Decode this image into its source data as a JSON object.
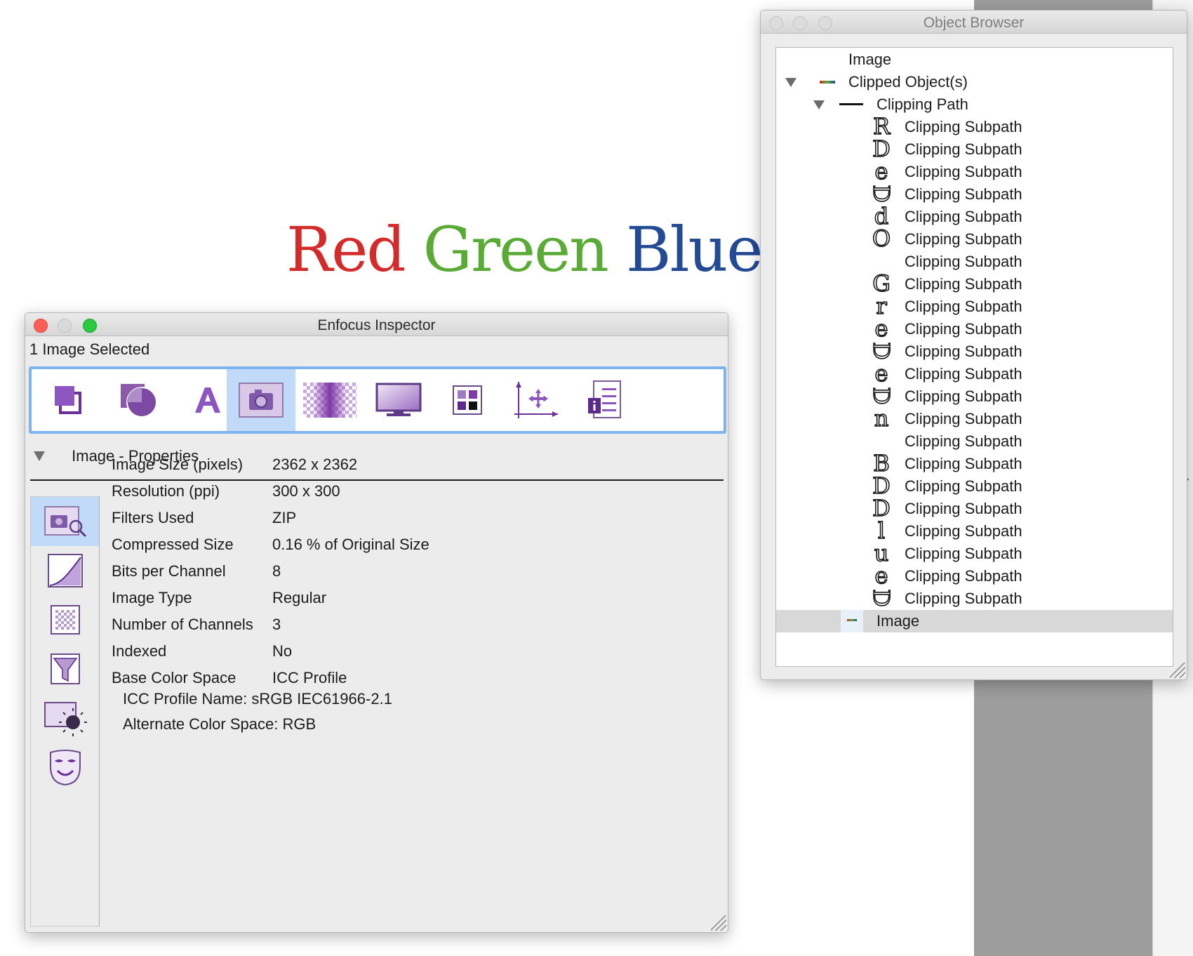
{
  "headline": {
    "red": "Red",
    "green": "Green",
    "blue": "Blue"
  },
  "colors": {
    "red": "#d42a2a",
    "green": "#5aab36",
    "blue": "#234a95",
    "accent": "#7fb3f0",
    "icon_purple": "#7b3fa6"
  },
  "inspector": {
    "title": "Enfocus Inspector",
    "selection": "1 Image Selected",
    "toolbar": [
      {
        "icon": "arrange-icon",
        "active": false
      },
      {
        "icon": "shape-icon",
        "active": false
      },
      {
        "icon": "text-icon",
        "active": false
      },
      {
        "icon": "camera-icon",
        "active": true
      },
      {
        "icon": "transparency-icon",
        "active": false
      },
      {
        "icon": "monitor-icon",
        "active": false
      },
      {
        "icon": "color-swatch-icon",
        "active": false
      },
      {
        "icon": "position-move-icon",
        "active": false
      },
      {
        "icon": "info-document-icon",
        "active": false
      }
    ],
    "section_title": "Image - Properties",
    "side_icons": [
      "image-properties-icon",
      "curve-icon",
      "checker-icon",
      "funnel-icon",
      "light-icon",
      "mask-icon"
    ],
    "properties": [
      {
        "key": "Image Size (pixels)",
        "value": "2362 x 2362"
      },
      {
        "key": "Resolution (ppi)",
        "value": "300 x 300"
      },
      {
        "key": "Filters Used",
        "value": "ZIP"
      },
      {
        "key": "Compressed Size",
        "value": "0.16 % of Original Size"
      },
      {
        "key": "Bits per Channel",
        "value": "8"
      },
      {
        "key": "Image Type",
        "value": "Regular"
      },
      {
        "key": "Number of Channels",
        "value": "3"
      },
      {
        "key": "Indexed",
        "value": "No"
      },
      {
        "key": "Base Color Space",
        "value": "ICC Profile"
      }
    ],
    "icc_profile_name": "ICC Profile Name: sRGB IEC61966-2.1",
    "alternate_color_space": "Alternate Color Space: RGB"
  },
  "browser": {
    "title": "Object Browser",
    "root": "Image",
    "clipped": "Clipped Object(s)",
    "clipping_path": "Clipping Path",
    "subpath_label": "Clipping Subpath",
    "subpaths": [
      {
        "glyph": "R",
        "rot": false
      },
      {
        "glyph": "D",
        "rot": false
      },
      {
        "glyph": "e",
        "rot": false
      },
      {
        "glyph": "D",
        "rot": true
      },
      {
        "glyph": "d",
        "rot": false
      },
      {
        "glyph": "O",
        "rot": false
      },
      {
        "glyph": "",
        "rot": false
      },
      {
        "glyph": "G",
        "rot": false
      },
      {
        "glyph": "r",
        "rot": false
      },
      {
        "glyph": "e",
        "rot": false
      },
      {
        "glyph": "D",
        "rot": true
      },
      {
        "glyph": "e",
        "rot": false
      },
      {
        "glyph": "D",
        "rot": true
      },
      {
        "glyph": "n",
        "rot": false
      },
      {
        "glyph": "",
        "rot": false
      },
      {
        "glyph": "B",
        "rot": false
      },
      {
        "glyph": "D",
        "rot": false
      },
      {
        "glyph": "D",
        "rot": false
      },
      {
        "glyph": "l",
        "rot": false
      },
      {
        "glyph": "u",
        "rot": false
      },
      {
        "glyph": "e",
        "rot": false
      },
      {
        "glyph": "D",
        "rot": true
      }
    ],
    "image_item": "Image"
  }
}
